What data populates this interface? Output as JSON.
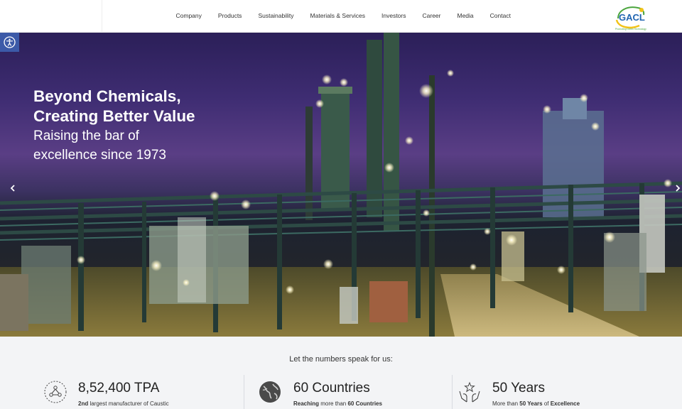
{
  "nav": {
    "items": [
      "Company",
      "Products",
      "Sustainability",
      "Materials & Services",
      "Investors",
      "Career",
      "Media",
      "Contact"
    ]
  },
  "logo": {
    "text": "GACL",
    "tagline": "Promoting Green Technology",
    "colors": {
      "blue": "#1f64b0",
      "green": "#4aa53d",
      "yellow": "#f2c318"
    }
  },
  "accessibility": {
    "icon": "accessibility-icon",
    "color": "#3c5aa8"
  },
  "hero": {
    "title_line1": "Beyond Chemicals,",
    "title_line2": "Creating Better Value",
    "sub_line1": "Raising the bar of",
    "sub_line2": "excellence since 1973",
    "prev_icon": "chevron-left-icon",
    "next_icon": "chevron-right-icon"
  },
  "stats": {
    "heading": "Let the numbers speak for us:",
    "items": [
      {
        "icon": "molecule-icon",
        "value": "8,52,400 TPA",
        "desc_bold": "2nd",
        "desc_rest": " largest manufacturer of Caustic"
      },
      {
        "icon": "globe-icon",
        "value": "60 Countries",
        "desc_bold": "Reaching",
        "desc_rest": " more than ",
        "desc_bold2": "60 Countries"
      },
      {
        "icon": "hands-star-icon",
        "value": "50 Years",
        "desc_pre": "More than ",
        "desc_bold": "50 Years",
        "desc_rest": " of ",
        "desc_bold2": "Excellence"
      }
    ]
  }
}
